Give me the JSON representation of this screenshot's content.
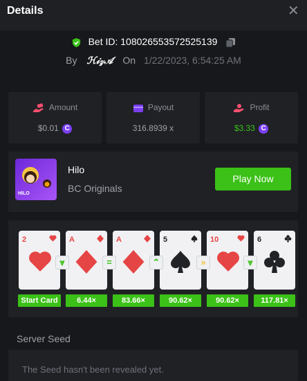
{
  "header": {
    "title": "Details",
    "close_icon": "close-icon"
  },
  "bet": {
    "id_text": "Bet ID: 108026553572525139",
    "by_label": "By",
    "username": "ℋ𝒾𝓏𝒜",
    "on_label": "On",
    "date": "1/22/2023, 6:54:25 AM",
    "verified_color": "#3bc117"
  },
  "stats": {
    "amount": {
      "label": "Amount",
      "value": "$0.01",
      "icon": "money-hand-icon"
    },
    "payout": {
      "label": "Payout",
      "value": "316.8939 x",
      "icon": "wallet-icon"
    },
    "profit": {
      "label": "Profit",
      "value": "$3.33",
      "icon": "profit-hand-icon",
      "color": "#3bc117"
    },
    "coin_symbol": "C"
  },
  "game": {
    "name": "Hilo",
    "provider": "BC Originals",
    "thumb_label": "HILO",
    "play_label": "Play Now"
  },
  "cards": [
    {
      "rank": "2",
      "suit": "heart",
      "multiplier": "Start Card"
    },
    {
      "rank": "A",
      "suit": "diamond",
      "multiplier": "6.44×"
    },
    {
      "rank": "A",
      "suit": "diamond",
      "multiplier": "83.66×"
    },
    {
      "rank": "5",
      "suit": "spade",
      "multiplier": "90.62×"
    },
    {
      "rank": "10",
      "suit": "heart",
      "multiplier": "90.62×"
    },
    {
      "rank": "6",
      "suit": "club",
      "multiplier": "117.81×"
    }
  ],
  "guesses": [
    "lower",
    "same",
    "higher",
    "skip",
    "lower"
  ],
  "seed": {
    "label": "Server Seed",
    "text": "The Seed hasn't been revealed yet."
  }
}
